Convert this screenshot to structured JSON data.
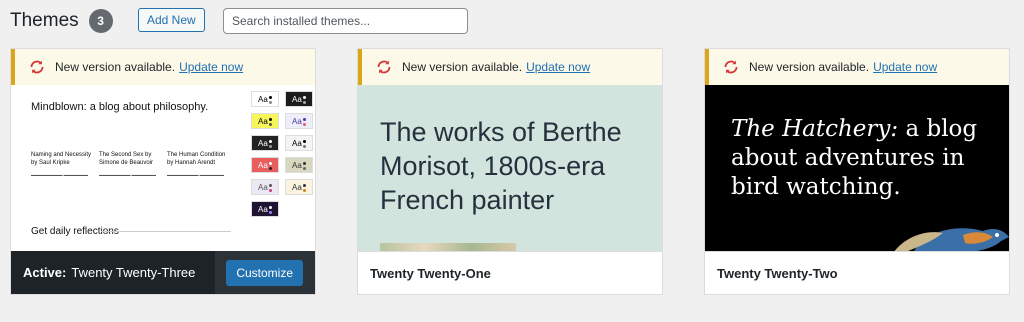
{
  "header": {
    "title": "Themes",
    "count": "3",
    "add_new_label": "Add New",
    "search_placeholder": "Search installed themes..."
  },
  "notice": {
    "text": "New version available.",
    "link": "Update now",
    "icon": "update-icon",
    "icon_color": "#d63638"
  },
  "themes": [
    {
      "name": "Twenty Twenty-Three",
      "active_prefix": "Active:",
      "action_label": "Customize",
      "preview": {
        "blog_title": "Mindblown: a blog about philosophy.",
        "posts": [
          {
            "title": "Naming and Necessity by Saul Kripke"
          },
          {
            "title": "The Second Sex by Simone de Beauvoir"
          },
          {
            "title": "The Human Condition by Hannah Arendt"
          }
        ],
        "tagline": "Get daily reflections",
        "swatch_label": "Aa"
      }
    },
    {
      "name": "Twenty Twenty-One",
      "preview": {
        "headline": "The works of Berthe Morisot, 1800s-era French painter"
      }
    },
    {
      "name": "Twenty Twenty-Two",
      "preview": {
        "headline_italic": "The Hatchery:",
        "headline_rest": " a blog about adventures in bird watching."
      }
    }
  ],
  "colors": {
    "accent": "#2271b1",
    "notice_border": "#dba617",
    "notice_bg": "#fcf9e8",
    "active_footer": "#1d2327"
  }
}
